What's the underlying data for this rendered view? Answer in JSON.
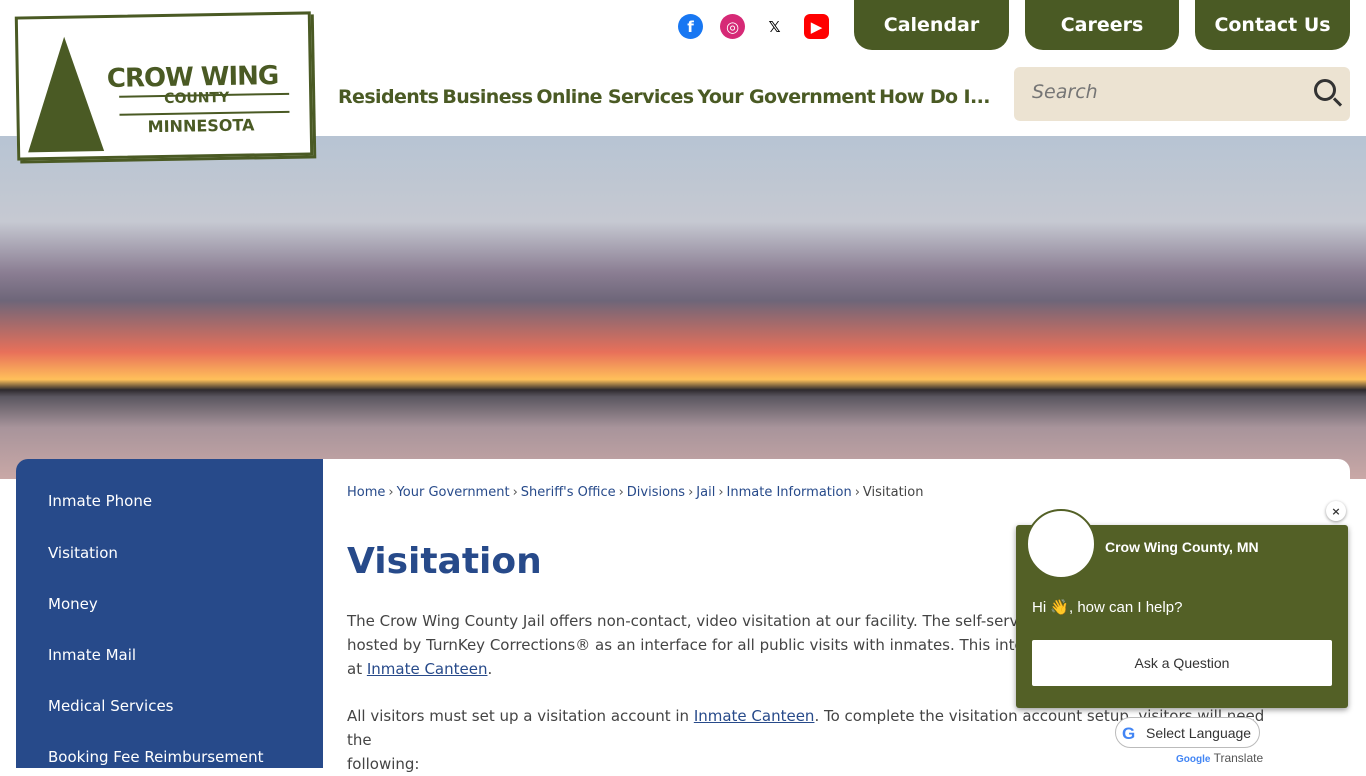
{
  "logo": {
    "line1": "CROW WING",
    "line2": "COUNTY",
    "line3": "MINNESOTA",
    "color": "#4a5a24"
  },
  "social": [
    {
      "name": "facebook-icon",
      "glyph": "f",
      "color": "#1877f2"
    },
    {
      "name": "instagram-icon",
      "glyph": "◎",
      "color": "#d62976"
    },
    {
      "name": "x-icon",
      "glyph": "𝕏",
      "color": "#000000"
    },
    {
      "name": "youtube-icon",
      "glyph": "▶",
      "color": "#ff0000"
    }
  ],
  "top_buttons": [
    "Calendar",
    "Careers",
    "Contact Us"
  ],
  "nav": [
    "Residents",
    "Business",
    "Online Services",
    "Your Government",
    "How Do I..."
  ],
  "search": {
    "placeholder": "Search"
  },
  "sidebar": [
    "Inmate Phone",
    "Visitation",
    "Money",
    "Inmate Mail",
    "Medical Services",
    "Booking Fee Reimbursement"
  ],
  "breadcrumb": [
    "Home",
    "Your Government",
    "Sheriff's Office",
    "Divisions",
    "Jail",
    "Inmate Information"
  ],
  "breadcrumb_current": "Visitation",
  "title": "Visitation",
  "para1": {
    "l1": "The Crow Wing County Jail offers non-contact, video visitation at our facility. The self-servic",
    "l2": "hosted by TurnKey Corrections® as an interface for all public visits with inmates. This interf",
    "l3_pre": "at ",
    "link": "Inmate Canteen",
    "l3_post": "."
  },
  "para2": {
    "pre": "All visitors must set up a visitation account in ",
    "link": "Inmate Canteen",
    "post": ". To complete the visitation account setup, visitors will need the",
    "l2": "following:"
  },
  "chat": {
    "name": "Crow Wing County, MN",
    "greeting": "Hi 👋, how can I help?",
    "button": "Ask a Question",
    "close": "×"
  },
  "translate": {
    "select": "Select Language",
    "g": "G",
    "google": "Google",
    "translate": "Translate"
  }
}
